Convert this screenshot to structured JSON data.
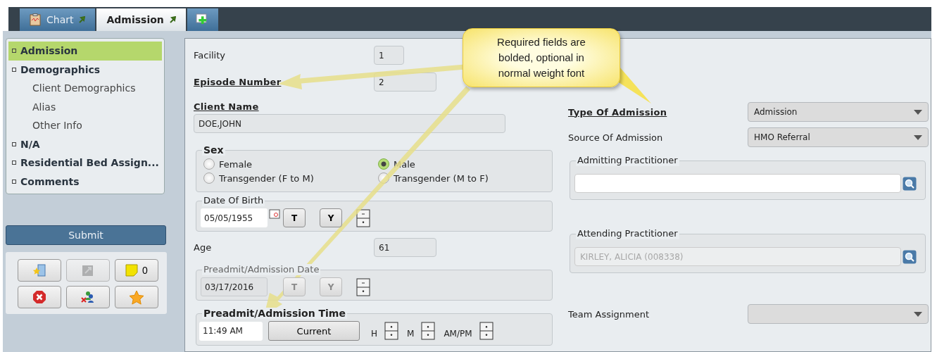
{
  "tabs": [
    {
      "label": "Chart",
      "kind": "chart",
      "selected": false
    },
    {
      "label": "Admission",
      "kind": "form",
      "selected": true
    },
    {
      "kind": "add",
      "selected": false
    }
  ],
  "nav": [
    {
      "label": "Admission",
      "selected": true
    },
    {
      "label": "Demographics",
      "selected": false,
      "children": [
        {
          "label": "Client Demographics",
          "selected": false
        },
        {
          "label": "Alias",
          "selected": false
        },
        {
          "label": "Other Info",
          "selected": false
        }
      ]
    },
    {
      "label": "N/A",
      "selected": false
    },
    {
      "label": "Residential Bed Assign...",
      "selected": false
    },
    {
      "label": "Comments",
      "selected": false
    }
  ],
  "submit": "Submit",
  "actions": [
    {
      "kind": "folder",
      "disabled": false
    },
    {
      "kind": "export",
      "disabled": true
    },
    {
      "kind": "note",
      "disabled": false,
      "label": "0"
    },
    {
      "kind": "delete",
      "disabled": false
    },
    {
      "kind": "users",
      "disabled": false
    },
    {
      "kind": "star",
      "disabled": false
    }
  ],
  "facility": {
    "label": "Facility",
    "value": "1",
    "required": false
  },
  "episode": {
    "label": "Episode Number",
    "value": "2",
    "required": true
  },
  "client_name": {
    "label": "Client Name",
    "value": "DOE,JOHN",
    "required": true
  },
  "sex": {
    "label": "Sex",
    "required": true,
    "options": [
      {
        "label": "Female",
        "selected": false
      },
      {
        "label": "Male",
        "selected": true
      },
      {
        "label": "Transgender (F to M)",
        "selected": false
      },
      {
        "label": "Transgender (M to F)",
        "selected": false
      }
    ]
  },
  "dob": {
    "label": "Date Of Birth",
    "value": "05/05/1955",
    "required": false,
    "disabled": false,
    "buttons": [
      "T",
      "Y"
    ]
  },
  "age": {
    "label": "Age",
    "value": "61",
    "required": false
  },
  "preadmit_date": {
    "label": "Preadmit/Admission Date",
    "value": "03/17/2016",
    "required": false,
    "disabled": true,
    "buttons": [
      "T",
      "Y"
    ]
  },
  "preadmit_time": {
    "label": "Preadmit/Admission Time",
    "value": "11:49 AM",
    "required": true,
    "button": "Current",
    "spinners": [
      "H",
      "M",
      "AM/PM"
    ]
  },
  "type_of_admission": {
    "label": "Type Of Admission",
    "value": "Admission",
    "required": true
  },
  "source_of_admission": {
    "label": "Source Of Admission",
    "value": "HMO Referral",
    "required": false
  },
  "admitting": {
    "label": "Admitting Practitioner",
    "disabled": false
  },
  "attending": {
    "label": "Attending Practitioner",
    "value": "KIRLEY, ALICIA (008338)",
    "disabled": true
  },
  "team_assignment": {
    "label": "Team Assignment",
    "required": false
  },
  "callout": "Required fields are bolded, optional in normal weight font"
}
